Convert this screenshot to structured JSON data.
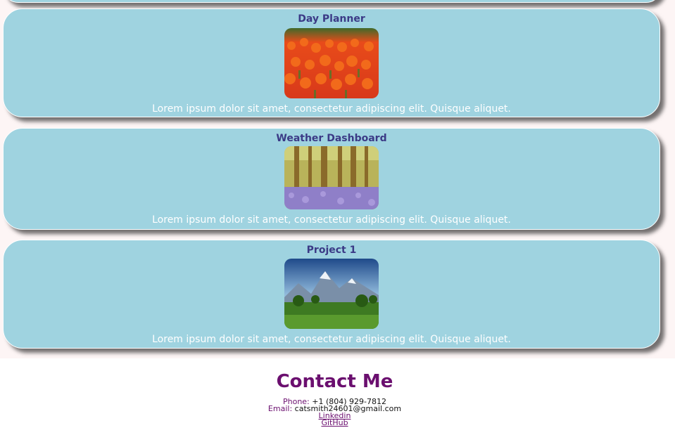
{
  "projects": [
    {
      "title": "Day Planner",
      "description": "Lorem ipsum dolor sit amet, consectetur adipiscing elit. Quisque aliquet.",
      "image": "tulip-field-photo"
    },
    {
      "title": "Weather Dashboard",
      "description": "Lorem ipsum dolor sit amet, consectetur adipiscing elit. Quisque aliquet.",
      "image": "bluebell-forest-photo"
    },
    {
      "title": "Project 1",
      "description": "Lorem ipsum dolor sit amet, consectetur adipiscing elit. Quisque aliquet.",
      "image": "mountain-meadow-photo"
    }
  ],
  "contact": {
    "title": "Contact Me",
    "phone_label": "Phone:",
    "phone": "+1 (804) 929-7812",
    "email_label": "Email:",
    "email": "catsmith24601@gmail.com",
    "linkedin": "Linkedin",
    "github": "GitHub"
  },
  "colors": {
    "card_bg": "#9fd3e0",
    "title_color": "#3b3a86",
    "contact_accent": "#6b0f6f"
  }
}
